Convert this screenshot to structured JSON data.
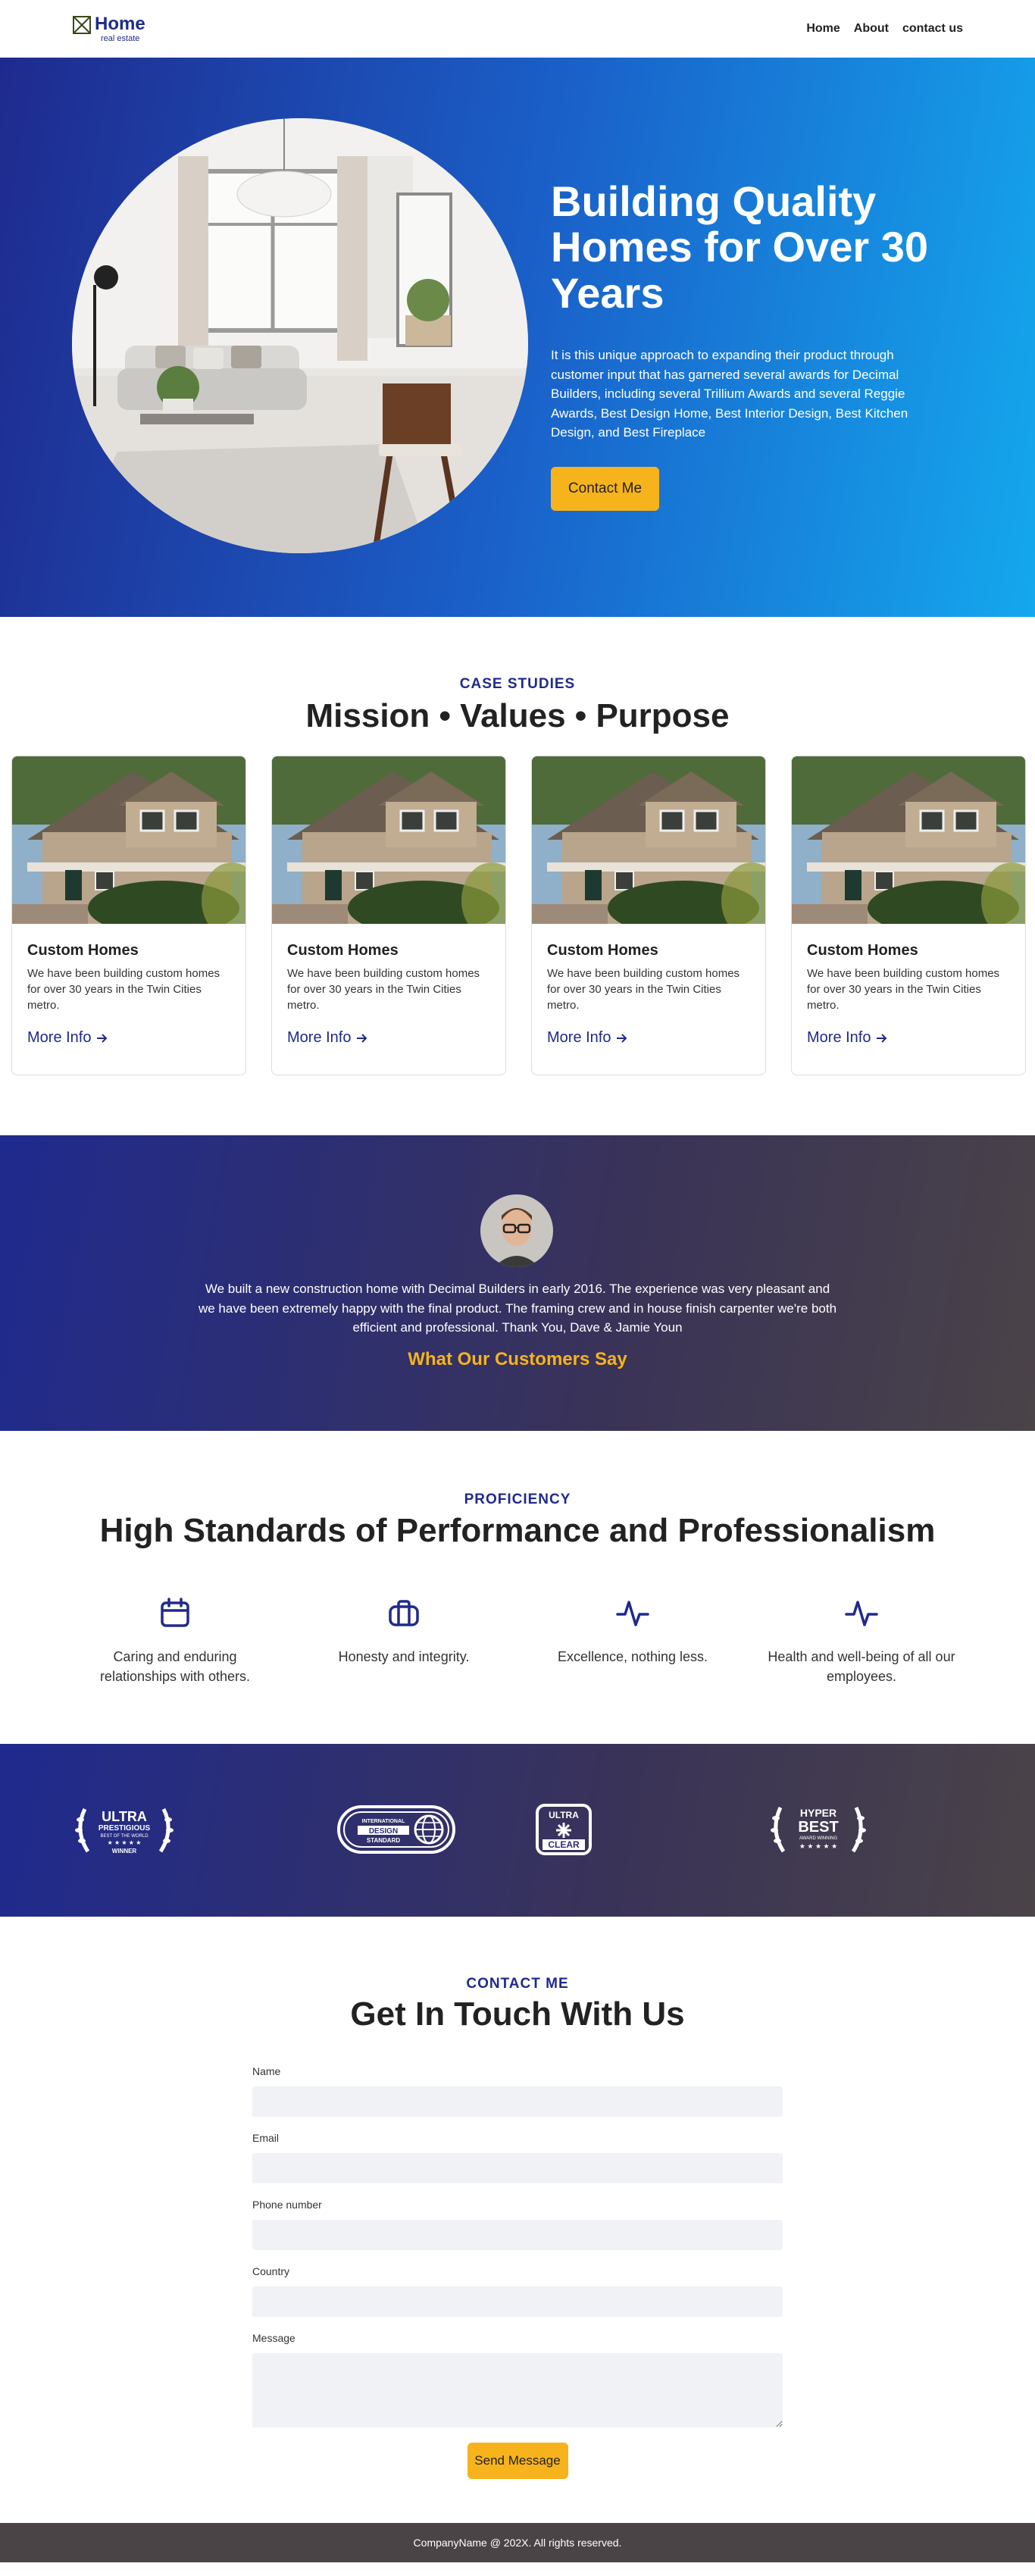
{
  "nav": {
    "brand_title": "Home",
    "brand_subtitle": "real estate",
    "links": [
      "Home",
      "About",
      "contact us"
    ]
  },
  "hero": {
    "title": "Building Quality Homes for Over 30 Years",
    "text": "It is this unique approach to expanding their product through customer input that has garnered several awards for Decimal Builders, including several Trillium Awards and several Reggie Awards, Best Design Home, Best Interior Design, Best Kitchen Design, and Best Fireplace",
    "button": "Contact Me"
  },
  "cases": {
    "eyebrow": "CASE STUDIES",
    "title": "Mission • Values • Purpose",
    "cards": [
      {
        "title": "Custom Homes",
        "text": "We have been building custom homes for over 30 years in the Twin Cities metro.",
        "link": "More Info"
      },
      {
        "title": "Custom Homes",
        "text": "We have been building custom homes for over 30 years in the Twin Cities metro.",
        "link": "More Info"
      },
      {
        "title": "Custom Homes",
        "text": "We have been building custom homes for over 30 years in the Twin Cities metro.",
        "link": "More Info"
      },
      {
        "title": "Custom Homes",
        "text": "We have been building custom homes for over 30 years in the Twin Cities metro.",
        "link": "More Info"
      }
    ]
  },
  "testimonial": {
    "quote": "We built a new construction home with Decimal Builders in early 2016. The experience was very pleasant and we have been extremely happy with the final product. The framing crew and in house finish carpenter we're both efficient and professional. Thank You, Dave & Jamie Youn",
    "heading": "What Our Customers Say"
  },
  "proficiency": {
    "eyebrow": "PROFICIENCY",
    "title": "High Standards of Performance and Professionalism",
    "features": [
      {
        "icon": "calendar-icon",
        "text": "Caring and enduring relationships with others."
      },
      {
        "icon": "briefcase-icon",
        "text": "Honesty and integrity."
      },
      {
        "icon": "pulse-icon",
        "text": "Excellence, nothing less."
      },
      {
        "icon": "pulse-icon",
        "text": "Health and well-being of all our employees."
      }
    ]
  },
  "awards": {
    "items": [
      {
        "icon": "laurel-award-icon",
        "line1": "ULTRA",
        "line2": "PRESTIGIOUS",
        "line3": "BEST OF THE WORLD",
        "line4": "WINNER"
      },
      {
        "icon": "globe-badge-icon",
        "line1": "INTERNATIONAL",
        "line2": "DESIGN",
        "line3": "STANDARD"
      },
      {
        "icon": "shield-badge-icon",
        "line1": "ULTRA",
        "line2": "CLEAR"
      },
      {
        "icon": "laurel-award-icon",
        "line1": "HYPER",
        "line2": "BEST",
        "line3": "AWARD WINNING"
      }
    ]
  },
  "contact": {
    "eyebrow": "CONTACT ME",
    "title": "Get In Touch With Us",
    "fields": {
      "name": {
        "label": "Name",
        "value": ""
      },
      "email": {
        "label": "Email",
        "value": ""
      },
      "phone": {
        "label": "Phone number",
        "value": ""
      },
      "country": {
        "label": "Country",
        "value": ""
      },
      "message": {
        "label": "Message",
        "value": ""
      }
    },
    "button": "Send Message"
  },
  "footer": {
    "copyright": "CompanyName @ 202X. All rights reserved."
  },
  "colors": {
    "brand": "#1f2a8c",
    "accent": "#f6b31c",
    "footer": "#4a4446"
  }
}
